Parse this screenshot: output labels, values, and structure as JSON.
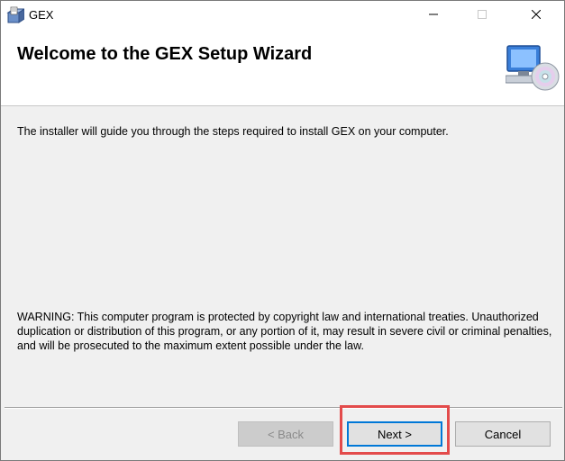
{
  "window": {
    "title": "GEX",
    "app_icon": "installer-box-icon",
    "controls": {
      "minimize": "minimize-icon",
      "maximize": "maximize-icon",
      "close": "close-icon"
    }
  },
  "header": {
    "title": "Welcome to the GEX Setup Wizard",
    "icon": "computer-cd-icon"
  },
  "body": {
    "intro": "The installer will guide you through the steps required to install GEX on your computer.",
    "warning": "WARNING: This computer program is protected by copyright law and international treaties. Unauthorized duplication or distribution of this program, or any portion of it, may result in severe civil or criminal penalties, and will be prosecuted to the maximum extent possible under the law."
  },
  "footer": {
    "back_label": "< Back",
    "back_enabled": false,
    "next_label": "Next >",
    "cancel_label": "Cancel"
  },
  "colors": {
    "dialog_bg": "#f0f0f0",
    "focus_border": "#0078d7",
    "highlight_border": "#e34b4b"
  }
}
